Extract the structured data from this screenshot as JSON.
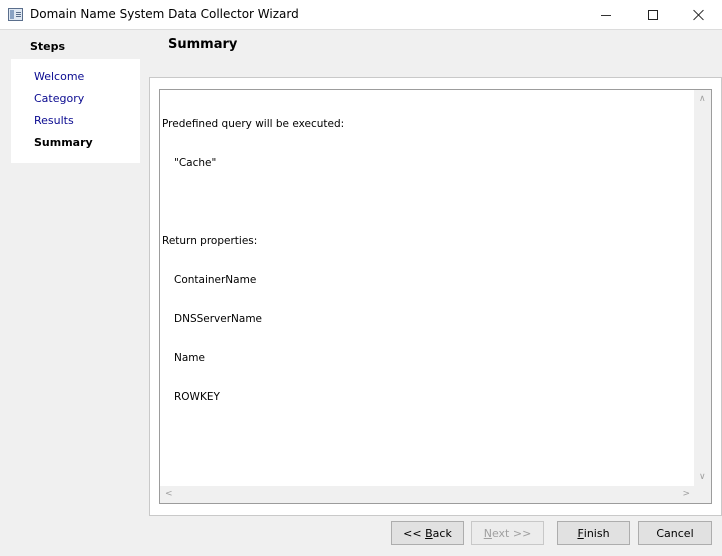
{
  "window": {
    "title": "Domain Name System Data Collector Wizard"
  },
  "steps": {
    "header": "Steps",
    "items": [
      {
        "label": "Welcome",
        "active": false
      },
      {
        "label": "Category",
        "active": false
      },
      {
        "label": "Results",
        "active": false
      },
      {
        "label": "Summary",
        "active": true
      }
    ]
  },
  "page": {
    "title": "Summary"
  },
  "summary_text": {
    "query_label": "Predefined query will be executed:",
    "query_value": "\"Cache\"",
    "properties_label": "Return properties:",
    "properties": [
      "ContainerName",
      "DNSServerName",
      "Name",
      "ROWKEY"
    ]
  },
  "buttons": {
    "back": {
      "prefix": "<< ",
      "accel": "B",
      "rest": "ack"
    },
    "next": {
      "accel": "N",
      "rest": "ext >>"
    },
    "finish": {
      "accel": "F",
      "rest": "inish"
    },
    "cancel": "Cancel"
  },
  "icons": {
    "app": "wizard-window-icon",
    "minimize": "minimize-icon",
    "maximize": "maximize-icon",
    "close": "close-icon"
  }
}
